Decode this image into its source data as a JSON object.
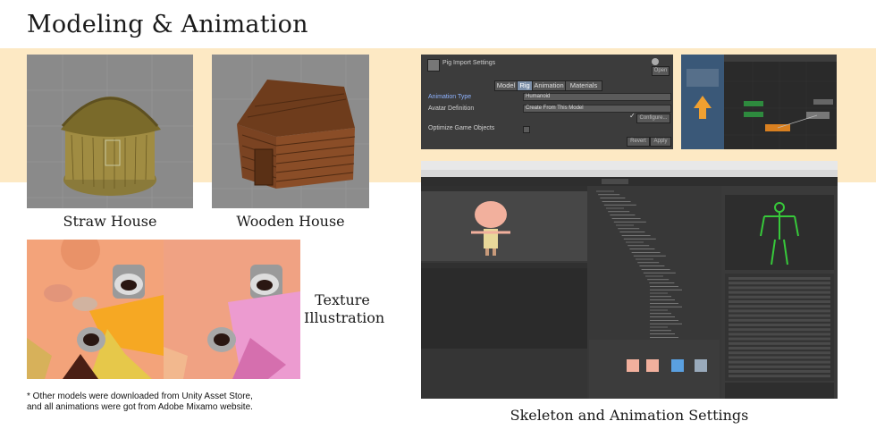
{
  "page": {
    "title": "Modeling & Animation",
    "note_line1": "* Other models were downloaded from Unity Asset Store,",
    "note_line2": "and all animations were got from Adobe Mixamo website."
  },
  "captions": {
    "straw_house": "Straw House",
    "wooden_house": "Wooden House",
    "texture_line1": "Texture",
    "texture_line2": "Illustration",
    "skeleton": "Skeleton and Animation Settings"
  },
  "import_settings": {
    "header": "Pig Import Settings",
    "open_button": "Open",
    "tabs": [
      "Model",
      "Rig",
      "Animation",
      "Materials"
    ],
    "selected_tab": "Rig",
    "animation_type_label": "Animation Type",
    "animation_type_value": "Humanoid",
    "avatar_definition_label": "Avatar Definition",
    "avatar_definition_value": "Create From This Model",
    "configure_button": "Configure...",
    "optimize_label": "Optimize Game Objects",
    "revert_button": "Revert",
    "apply_button": "Apply"
  },
  "colors": {
    "band": "#fde9c4",
    "unity_dark": "#3c3c3c",
    "unity_accent": "#7c8fa8",
    "humanoid_green": "#37c93a"
  }
}
